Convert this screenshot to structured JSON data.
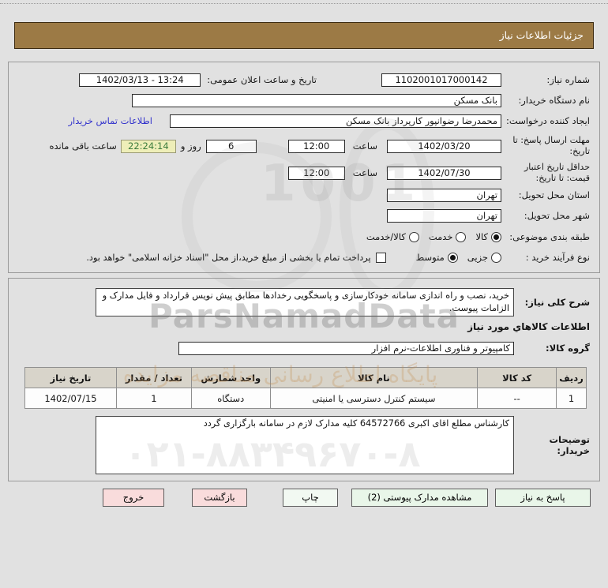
{
  "title_bar": {
    "label": "جزئیات اطلاعات نیاز"
  },
  "form": {
    "need_number": {
      "label": "شماره نیاز:",
      "value": "1102001017000142"
    },
    "announce_datetime": {
      "label": "تاریخ و ساعت اعلان عمومی:",
      "value": "1402/03/13 - 13:24"
    },
    "buyer_org": {
      "label": "نام دستگاه خریدار:",
      "value": "بانک مسکن"
    },
    "request_creator": {
      "label": "ایجاد کننده درخواست:",
      "value": "محمدرضا رضوانپور کارپرداز بانک مسکن",
      "contact_link": "اطلاعات تماس خریدار"
    },
    "response_deadline": {
      "label": "مهلت ارسال پاسخ: تا تاریخ:",
      "date": "1402/03/20",
      "hour_label": "ساعت",
      "time": "12:00",
      "days": "6",
      "days_label": "روز و",
      "countdown": "22:24:14",
      "countdown_label": "ساعت باقی مانده"
    },
    "price_validity": {
      "label": "حداقل تاریخ اعتبار قیمت: تا تاریخ:",
      "date": "1402/07/30",
      "hour_label": "ساعت",
      "time": "12:00"
    },
    "delivery_province": {
      "label": "استان محل تحویل:",
      "value": "تهران"
    },
    "delivery_city": {
      "label": "شهر محل تحویل:",
      "value": "تهران"
    },
    "subject_class": {
      "label": "طبقه بندی موضوعی:",
      "options": [
        {
          "label": "کالا",
          "selected": true
        },
        {
          "label": "خدمت",
          "selected": false
        },
        {
          "label": "کالا/خدمت",
          "selected": false
        }
      ]
    },
    "purchase_type": {
      "label": "نوع فرآیند خرید :",
      "options": [
        {
          "label": "جزیی",
          "selected": false
        },
        {
          "label": "متوسط",
          "selected": true
        }
      ],
      "treasury_checkbox_label": "پرداخت تمام یا بخشی از مبلغ خرید،از محل \"اسناد خزانه اسلامی\" خواهد بود.",
      "treasury_checked": false
    }
  },
  "description": {
    "label": "شرح کلی نیاز:",
    "value": "خرید، نصب و راه اندازی سامانه خودکارسازی و پاسخگویی رخدادها مطابق پیش نویس قرارداد و فایل مدارک و الزامات پیوست."
  },
  "goods_section": {
    "heading": "اطلاعات کالاهاي مورد نیاز",
    "group": {
      "label": "گروه کالا:",
      "value": "کامپیوتر و فناوری اطلاعات-نرم افزار"
    },
    "table": {
      "headers": [
        "ردیف",
        "کد کالا",
        "نام کالا",
        "واحد شمارش",
        "تعداد / مقدار",
        "تاریخ نیاز"
      ],
      "rows": [
        [
          "1",
          "--",
          "سیستم کنترل دسترسی یا امنیتی",
          "دستگاه",
          "1",
          "1402/07/15"
        ]
      ]
    }
  },
  "buyer_notes": {
    "label": "توضیحات خریدار:",
    "value": "کارشناس مطلع اقای اکبری 64572766 کلیه مدارک لازم در سامانه بارگزاری گردد"
  },
  "buttons": [
    {
      "label": "پاسخ به نیاز",
      "style": "green"
    },
    {
      "label": "مشاهده مدارک پیوستی (2)",
      "style": "green"
    },
    {
      "label": "چاپ",
      "style": "white"
    },
    {
      "label": "بازگشت",
      "style": "pink"
    },
    {
      "label": "خروج",
      "style": "pink"
    }
  ],
  "watermarks": {
    "brand": "ParsNamadData",
    "line": "پایگاه اطلاع رسانی مناقصه مزایده",
    "phone": "۰۲۱-۸۸۳۴۹۶۷۰-۸",
    "emblem_digits": "1001"
  },
  "colors": {
    "header_bg": "#9c7a45",
    "link": "#3333cc",
    "countdown_bg": "#eeeeb8",
    "countdown_text": "#3e7d3e",
    "button_pink": "#f9dcdc",
    "button_green": "#e9f6e9",
    "button_white": "#f2f9f2"
  }
}
